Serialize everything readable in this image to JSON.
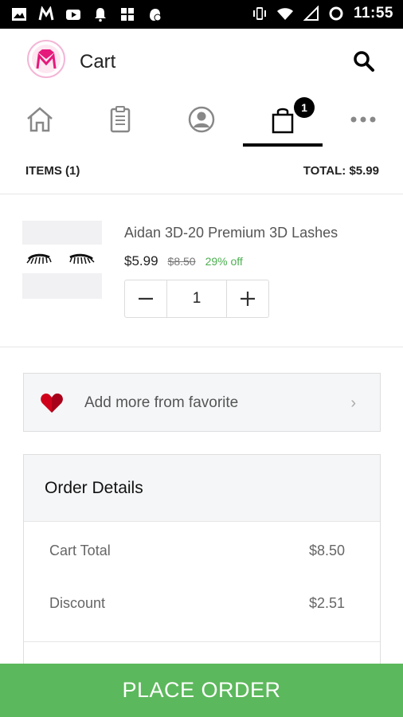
{
  "status_bar": {
    "time": "11:55",
    "left_icons": [
      "image-icon",
      "m-app-icon",
      "youtube-icon",
      "bell-icon",
      "grid-icon",
      "badge-app-icon"
    ],
    "right_icons": [
      "vibrate-icon",
      "wifi-icon",
      "signal-icon",
      "sync-icon"
    ]
  },
  "app_bar": {
    "title": "Cart",
    "logo_letter": "M",
    "brand_color": "#e5197c"
  },
  "tabs": [
    {
      "name": "home",
      "icon": "home-icon",
      "active": false
    },
    {
      "name": "orders",
      "icon": "clipboard-icon",
      "active": false
    },
    {
      "name": "account",
      "icon": "user-icon",
      "active": false
    },
    {
      "name": "cart",
      "icon": "bag-icon",
      "active": true,
      "badge": "1"
    },
    {
      "name": "more",
      "icon": "more-icon",
      "active": false
    }
  ],
  "summary": {
    "items": "ITEMS (1)",
    "total": "TOTAL: $5.99"
  },
  "product": {
    "name": "Aidan 3D-20 Premium 3D Lashes",
    "price": "$5.99",
    "old_price": "$8.50",
    "discount": "29% off",
    "quantity": "1",
    "minus": "−",
    "plus": "+"
  },
  "favorites": {
    "label": "Add more from favorite",
    "chevron": "›"
  },
  "order_details": {
    "heading": "Order Details",
    "rows": [
      {
        "label": "Cart Total",
        "value": "$8.50"
      },
      {
        "label": "Discount",
        "value": "$2.51"
      }
    ]
  },
  "cta": {
    "label": "PLACE ORDER",
    "color": "#5cb85c"
  }
}
